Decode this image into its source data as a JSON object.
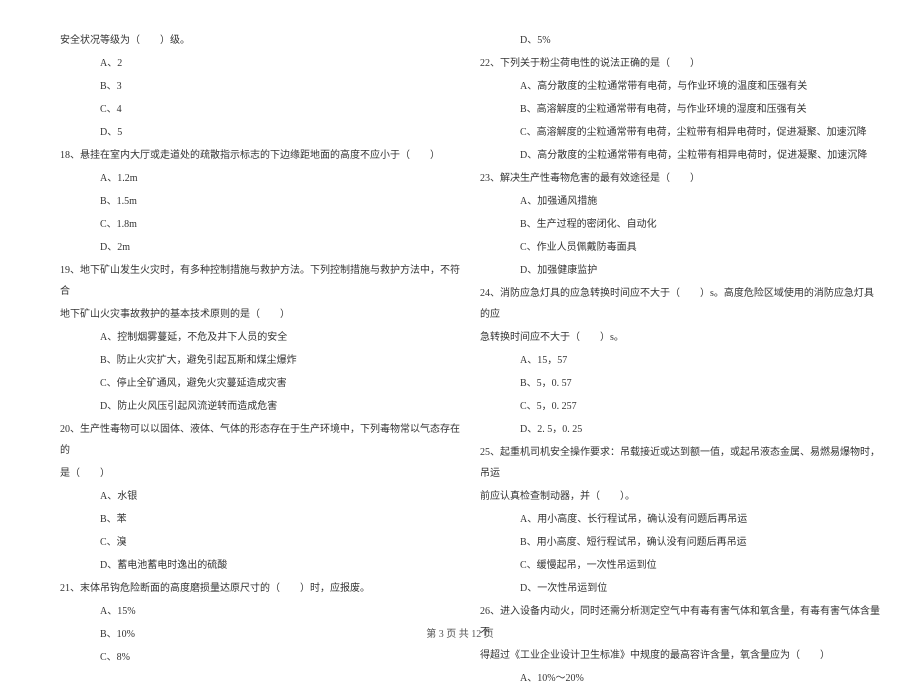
{
  "left_column": {
    "intro_line": "安全状况等级为（　　）级。",
    "q17_options": {
      "a": "A、2",
      "b": "B、3",
      "c": "C、4",
      "d": "D、5"
    },
    "q18": {
      "text": "18、悬挂在室内大厅或走道处的疏散指示标志的下边缘距地面的高度不应小于（　　）",
      "options": {
        "a": "A、1.2m",
        "b": "B、1.5m",
        "c": "C、1.8m",
        "d": "D、2m"
      }
    },
    "q19": {
      "line1": "19、地下矿山发生火灾时，有多种控制措施与救护方法。下列控制措施与救护方法中，不符合",
      "line2": "地下矿山火灾事故救护的基本技术原则的是（　　）",
      "options": {
        "a": "A、控制烟雾蔓延，不危及井下人员的安全",
        "b": "B、防止火灾扩大，避免引起瓦斯和煤尘爆炸",
        "c": "C、停止全矿通风，避免火灾蔓延造成灾害",
        "d": "D、防止火风压引起风流逆转而造成危害"
      }
    },
    "q20": {
      "line1": "20、生产性毒物可以以固体、液体、气体的形态存在于生产环境中，下列毒物常以气态存在的",
      "line2": "是（　　）",
      "options": {
        "a": "A、水银",
        "b": "B、苯",
        "c": "C、溴",
        "d": "D、蓄电池蓄电时逸出的硫酸"
      }
    },
    "q21": {
      "text": "21、末体吊钩危险断面的高度磨损量达原尺寸的（　　）时，应报废。",
      "options": {
        "a": "A、15%",
        "b": "B、10%",
        "c": "C、8%"
      }
    }
  },
  "right_column": {
    "q21_d": "D、5%",
    "q22": {
      "text": "22、下列关于粉尘荷电性的说法正确的是（　　）",
      "options": {
        "a": "A、高分散度的尘粒通常带有电荷，与作业环境的温度和压强有关",
        "b": "B、高溶解度的尘粒通常带有电荷，与作业环境的湿度和压强有关",
        "c": "C、高溶解度的尘粒通常带有电荷，尘粒带有相异电荷时，促进凝聚、加速沉降",
        "d": "D、高分散度的尘粒通常带有电荷，尘粒带有相异电荷时，促进凝聚、加速沉降"
      }
    },
    "q23": {
      "text": "23、解决生产性毒物危害的最有效途径是（　　）",
      "options": {
        "a": "A、加强通风措施",
        "b": "B、生产过程的密闭化、自动化",
        "c": "C、作业人员佩戴防毒面具",
        "d": "D、加强健康监护"
      }
    },
    "q24": {
      "line1": "24、消防应急灯具的应急转换时间应不大于（　　）s。高度危险区域使用的消防应急灯具的应",
      "line2": "急转换时间应不大于（　　）s。",
      "options": {
        "a": "A、15，57",
        "b": "B、5，0. 57",
        "c": "C、5，0. 257",
        "d": "D、2. 5，0. 25"
      }
    },
    "q25": {
      "line1": "25、起重机司机安全操作要求：吊载接近或达到额一值，或起吊液态金属、易燃易爆物时，吊运",
      "line2": "前应认真检查制动器，并（　　）。",
      "options": {
        "a": "A、用小高度、长行程试吊，确认没有问题后再吊运",
        "b": "B、用小高度、短行程试吊，确认没有问题后再吊运",
        "c": "C、缓慢起吊，一次性吊运到位",
        "d": "D、一次性吊运到位"
      }
    },
    "q26": {
      "line1": "26、进入设备内动火，同时还需分析测定空气中有毒有害气体和氧含量，有毒有害气体含量不",
      "line2": "得超过《工业企业设计卫生标准》中规度的最高容许含量，氧含量应为（　　）",
      "options": {
        "a": "A、10%～20%"
      }
    }
  },
  "footer": "第 3 页 共 12 页"
}
